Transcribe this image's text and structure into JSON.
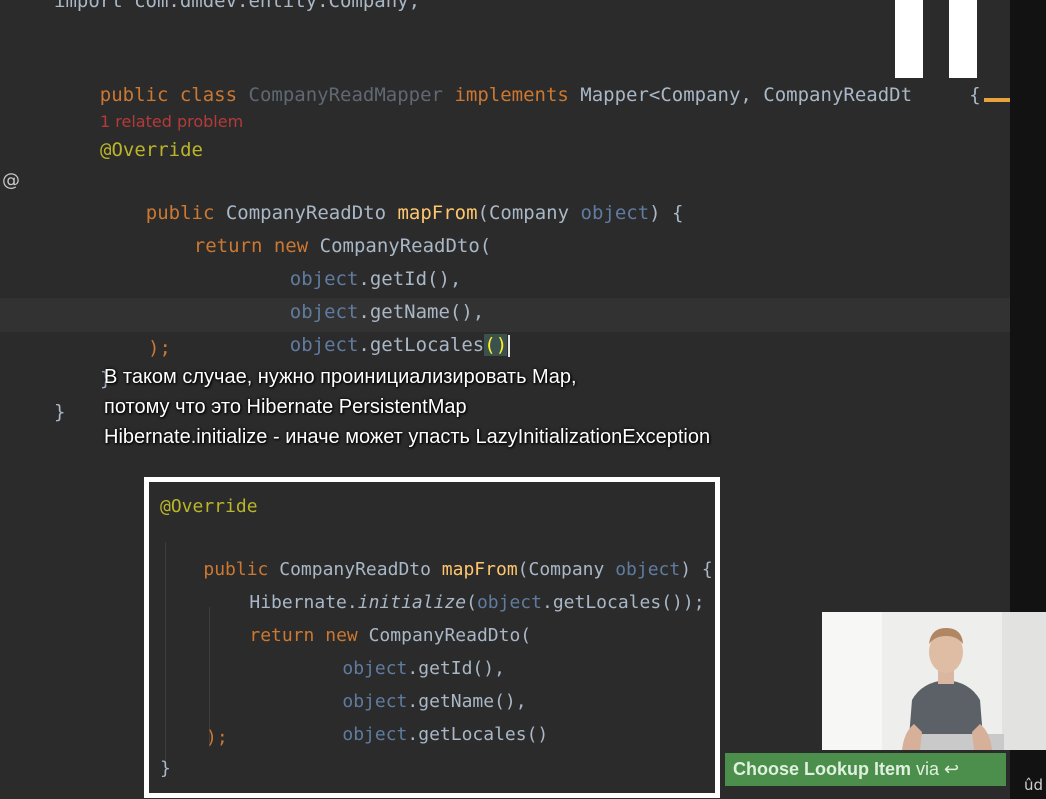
{
  "editor": {
    "import_line": "import com.dmdev.entity.Company;",
    "class_decl": {
      "public": "public",
      "class_kw": "class",
      "class_name": "CompanyReadMapper",
      "implements": "implements",
      "iface": "Mapper<Company, CompanyReadDt",
      "brace": "{"
    },
    "related_problem": "1 related problem",
    "override": "@Override",
    "gutter_symbol": "@",
    "method": {
      "public": "public",
      "return_type": "CompanyReadDto",
      "name": "mapFrom",
      "open": "(Company ",
      "param": "object",
      "close": ") {"
    },
    "return_kw": "return",
    "new_kw": "new",
    "ctor": "CompanyReadDto(",
    "arg_object": "object",
    "arg1": ".getId(),",
    "arg2": ".getName(),",
    "arg3_call": ".getLocales",
    "arg3_parens": "()",
    "close_paren": ");",
    "close_brace_inner": "}",
    "close_brace_outer": "}"
  },
  "caption": {
    "line1": "В таком случае, нужно проинициализировать Map,",
    "line2": "потому что это Hibernate PersistentMap",
    "line3": "Hibernate.initialize - иначе может упасть LazyInitializationException"
  },
  "snippet": {
    "override": "@Override",
    "public": "public",
    "return_type": "CompanyReadDto",
    "name": "mapFrom",
    "open": "(Company ",
    "param": "object",
    "close": ") {",
    "hib_class": "Hibernate.",
    "hib_method": "initialize",
    "hib_open": "(",
    "hib_obj": "object",
    "hib_rest": ".getLocales());",
    "return_kw": "return",
    "new_kw": "new",
    "ctor": "CompanyReadDto(",
    "arg_object": "object",
    "arg1": ".getId(),",
    "arg2": ".getName(),",
    "arg3": ".getLocales()",
    "close_paren": ");",
    "close_brace": "}"
  },
  "lookup": {
    "label": "Choose Lookup Item",
    "via": " via ↩"
  },
  "corner_text": "ûd",
  "colors": {
    "background": "#2b2b2b",
    "keyword": "#cc7832",
    "function": "#ffc66d",
    "annotation": "#bbb529",
    "param": "#5f7ca0",
    "lookup_green": "#4c8f4c"
  }
}
